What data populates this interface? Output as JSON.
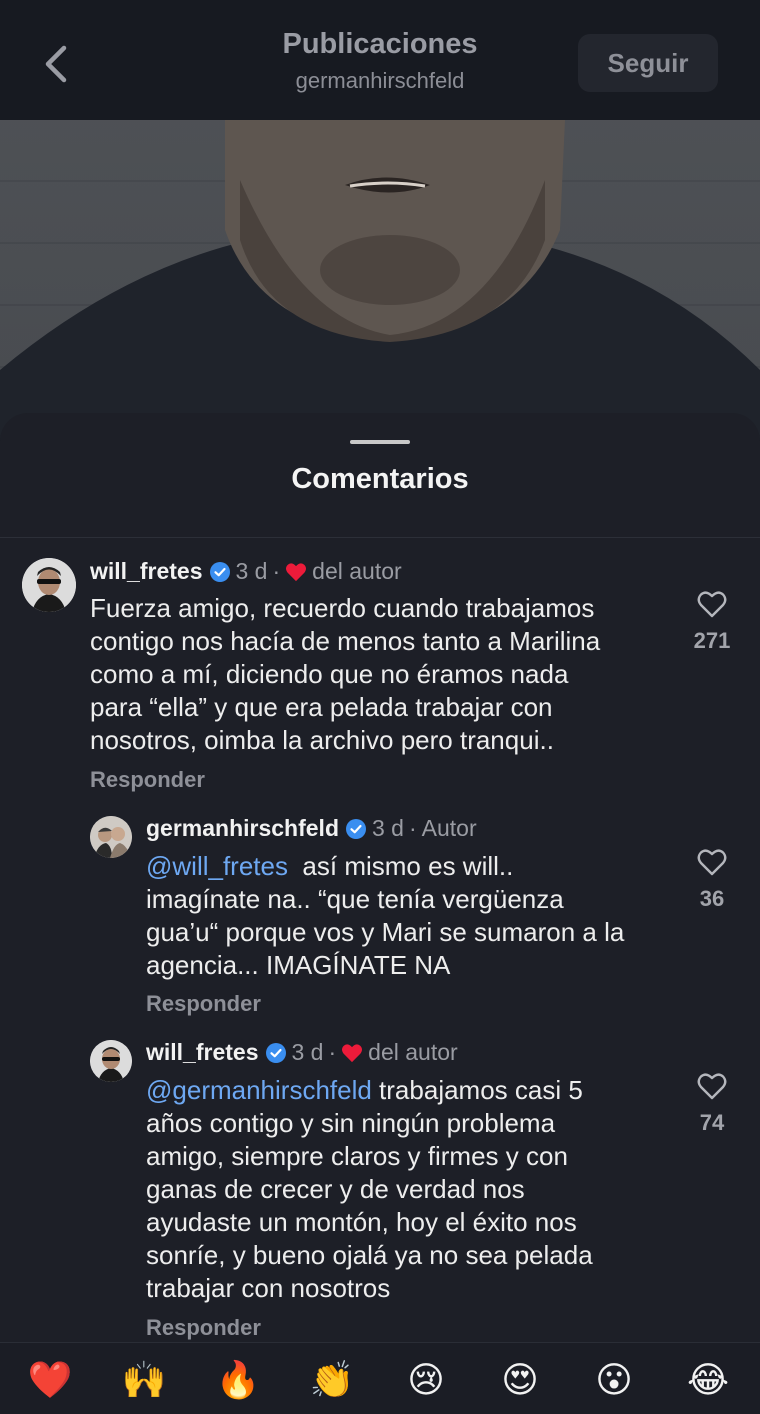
{
  "header": {
    "title": "Publicaciones",
    "subtitle": "germanhirschfeld",
    "follow_label": "Seguir"
  },
  "sheet": {
    "title": "Comentarios"
  },
  "comments": [
    {
      "username": "will_fretes",
      "time": "3 d",
      "separator": "·",
      "badge": "del autor",
      "badge_heart": true,
      "body": "Fuerza amigo, recuerdo cuando trabajamos contigo nos hacía de menos tanto a Marilina como a mí, diciendo que no éramos nada para “ella” y que era pelada trabajar con nosotros, oimba la archivo pero tranqui..",
      "lines": [
        "Fuerza amigo, recuerdo cuando trabajamos",
        "contigo nos hacía de menos tanto a Marilina",
        "como a mí, diciendo que no éramos nada",
        "para “ella” y que era pelada trabajar con",
        "nosotros, oimba la archivo pero tranqui.."
      ],
      "reply_label": "Responder",
      "likes": "271"
    },
    {
      "username": "germanhirschfeld",
      "time": "3 d",
      "separator": "·",
      "badge": "Autor",
      "badge_heart": false,
      "mention": "@will_fretes",
      "lines": [
        "  así mismo es will..",
        "imagínate na.. “que tenía vergüenza",
        "gua’u“ porque vos y Mari se sumaron a la",
        "agencia... IMAGÍNATE NA"
      ],
      "reply_label": "Responder",
      "likes": "36"
    },
    {
      "username": "will_fretes",
      "time": "3 d",
      "separator": "·",
      "badge": "del autor",
      "badge_heart": true,
      "mention": "@germanhirschfeld",
      "lines": [
        " trabajamos casi 5",
        "años contigo y sin ningún problema",
        "amigo, siempre claros y firmes y con",
        "ganas de crecer y de verdad nos",
        "ayudaste un montón, hoy el éxito nos",
        "sonríe, y bueno ojalá ya no sea pelada",
        "trabajar con nosotros"
      ],
      "reply_label": "Responder",
      "likes": "74"
    }
  ],
  "emoji_reactions": [
    "❤️",
    "🙌",
    "🔥",
    "👏",
    "😢",
    "😍",
    "😮",
    "😂"
  ],
  "colors": {
    "background": "#1d1f27",
    "mention": "#6ea8f2",
    "verified": "#3a8ef0",
    "heart": "#ed1b3a"
  }
}
